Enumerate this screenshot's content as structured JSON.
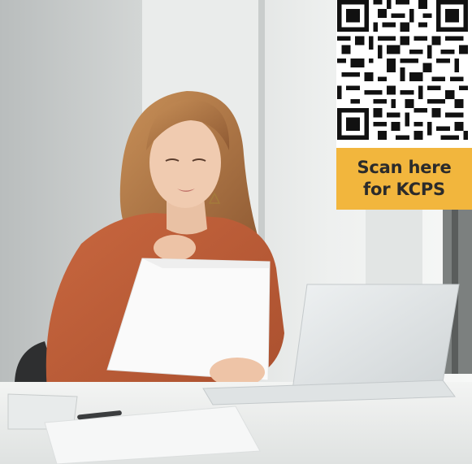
{
  "promo": {
    "scan_line1": "Scan here",
    "scan_line2": "for KCPS"
  },
  "photo": {
    "subject": "woman reviewing a document at a laptop",
    "colors": {
      "blouse": "#c2603a",
      "hair": "#b97a4a",
      "background": "#d9dcdc",
      "banner": "#f2b63d"
    }
  },
  "icons": [
    "qr-code-icon"
  ]
}
